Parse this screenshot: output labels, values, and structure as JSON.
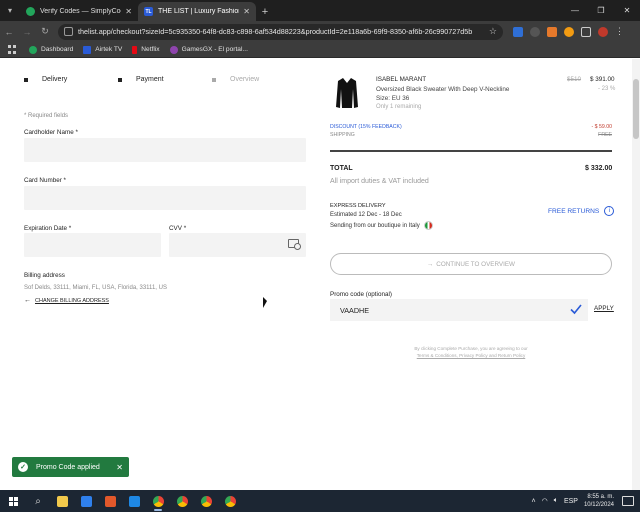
{
  "browser": {
    "tabs": [
      {
        "title": "Verify Codes — SimplyCodes",
        "active": false
      },
      {
        "title": "THE LIST | Luxury Fashion Pow...",
        "active": true
      }
    ],
    "url": "thelist.app/checkout?sizeId=5c935350-64f8-dc83-c898-6af534d88223&productId=2e118a6b-69f9-8350-af6b-26c990727d5b",
    "bookmarks": [
      {
        "label": "Dashboard",
        "color": "#22a55b"
      },
      {
        "label": "Airtek TV",
        "color": "#2a5bd7"
      },
      {
        "label": "Netflix",
        "color": "#e50914"
      },
      {
        "label": "GamesGX - El portal...",
        "color": "#8e44ad"
      }
    ]
  },
  "checkout": {
    "steps": [
      {
        "label": "Delivery",
        "state": "done"
      },
      {
        "label": "Payment",
        "state": "current"
      },
      {
        "label": "Overview",
        "state": "inactive"
      }
    ],
    "required_note": "* Required fields",
    "cardholder_label": "Cardholder Name *",
    "card_number_label": "Card Number *",
    "expiration_label": "Expiration Date *",
    "cvv_label": "CVV *",
    "billing_title": "Billing address",
    "billing_address": "Sof Delds, 33111, Miami, FL, USA, Florida, 33111, US",
    "change_billing": "CHANGE BILLING ADDRESS"
  },
  "summary": {
    "brand": "ISABEL MARANT",
    "product_name": "Oversized Black Sweater With Deep V-Neckline",
    "size": "Size: EU 36",
    "remaining": "Only 1 remaining",
    "price_old": "$510",
    "price_new": "$ 391.00",
    "discount_pct": "- 23 %",
    "discount_label": "DISCOUNT (15% FEEDBACK)",
    "discount_value": "- $ 59.00",
    "shipping_label": "SHIPPING",
    "shipping_value": "FREE",
    "total_label": "TOTAL",
    "total_value": "$ 332.00",
    "duties_note": "All import duties & VAT included",
    "express_title": "EXPRESS DELIVERY",
    "express_dates": "Estimated 12 Dec - 18 Dec",
    "sending_from": "Sending from our boutique in Italy",
    "free_returns": "FREE RETURNS",
    "continue_label": "CONTINUE TO OVERVIEW",
    "promo_label": "Promo code (optional)",
    "promo_value": "VAADHE",
    "apply_label": "APPLY",
    "disclaimer_line1": "By clicking Complete Purchase, you are agreeing to our",
    "disclaimer_line2": "Terms & Conditions, Privacy Policy and Return Policy"
  },
  "toast": {
    "message": "Promo Code applied"
  },
  "taskbar": {
    "language": "ESP",
    "time": "8:55 a. m.",
    "date": "10/12/2024"
  },
  "colors": {
    "accent_blue": "#2a5bd7",
    "toast_green": "#227a3f",
    "discount_red": "#c0392b"
  }
}
